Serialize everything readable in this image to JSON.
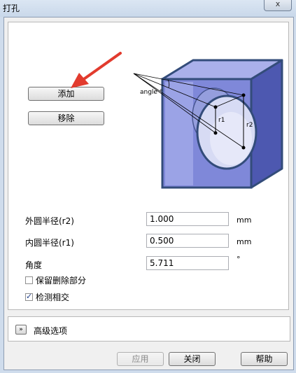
{
  "window": {
    "title": "打孔",
    "close_glyph": "x"
  },
  "actions": {
    "add_label": "添加",
    "remove_label": "移除"
  },
  "diagram": {
    "angle_label": "angle °",
    "r1_label": "r1",
    "r2_label": "r2",
    "colors": {
      "block_front": "#7f88d9",
      "block_side": "#4d58b0",
      "block_top": "#aab0ea",
      "outline": "#334c7a",
      "arrow": "#e23b2e"
    }
  },
  "fields": [
    {
      "label": "外圆半径(r2)",
      "value": "1.000",
      "unit": "mm"
    },
    {
      "label": "内圆半径(r1)",
      "value": "0.500",
      "unit": "mm"
    },
    {
      "label": "角度",
      "value": "5.711",
      "unit": "°"
    }
  ],
  "options": [
    {
      "label": "保留删除部分",
      "checked": false
    },
    {
      "label": "检测相交",
      "checked": true
    }
  ],
  "advanced": {
    "label": "高级选项",
    "toggle_glyph": "»"
  },
  "footer": {
    "apply_label": "应用",
    "close_label": "关闭",
    "help_label": "帮助"
  }
}
